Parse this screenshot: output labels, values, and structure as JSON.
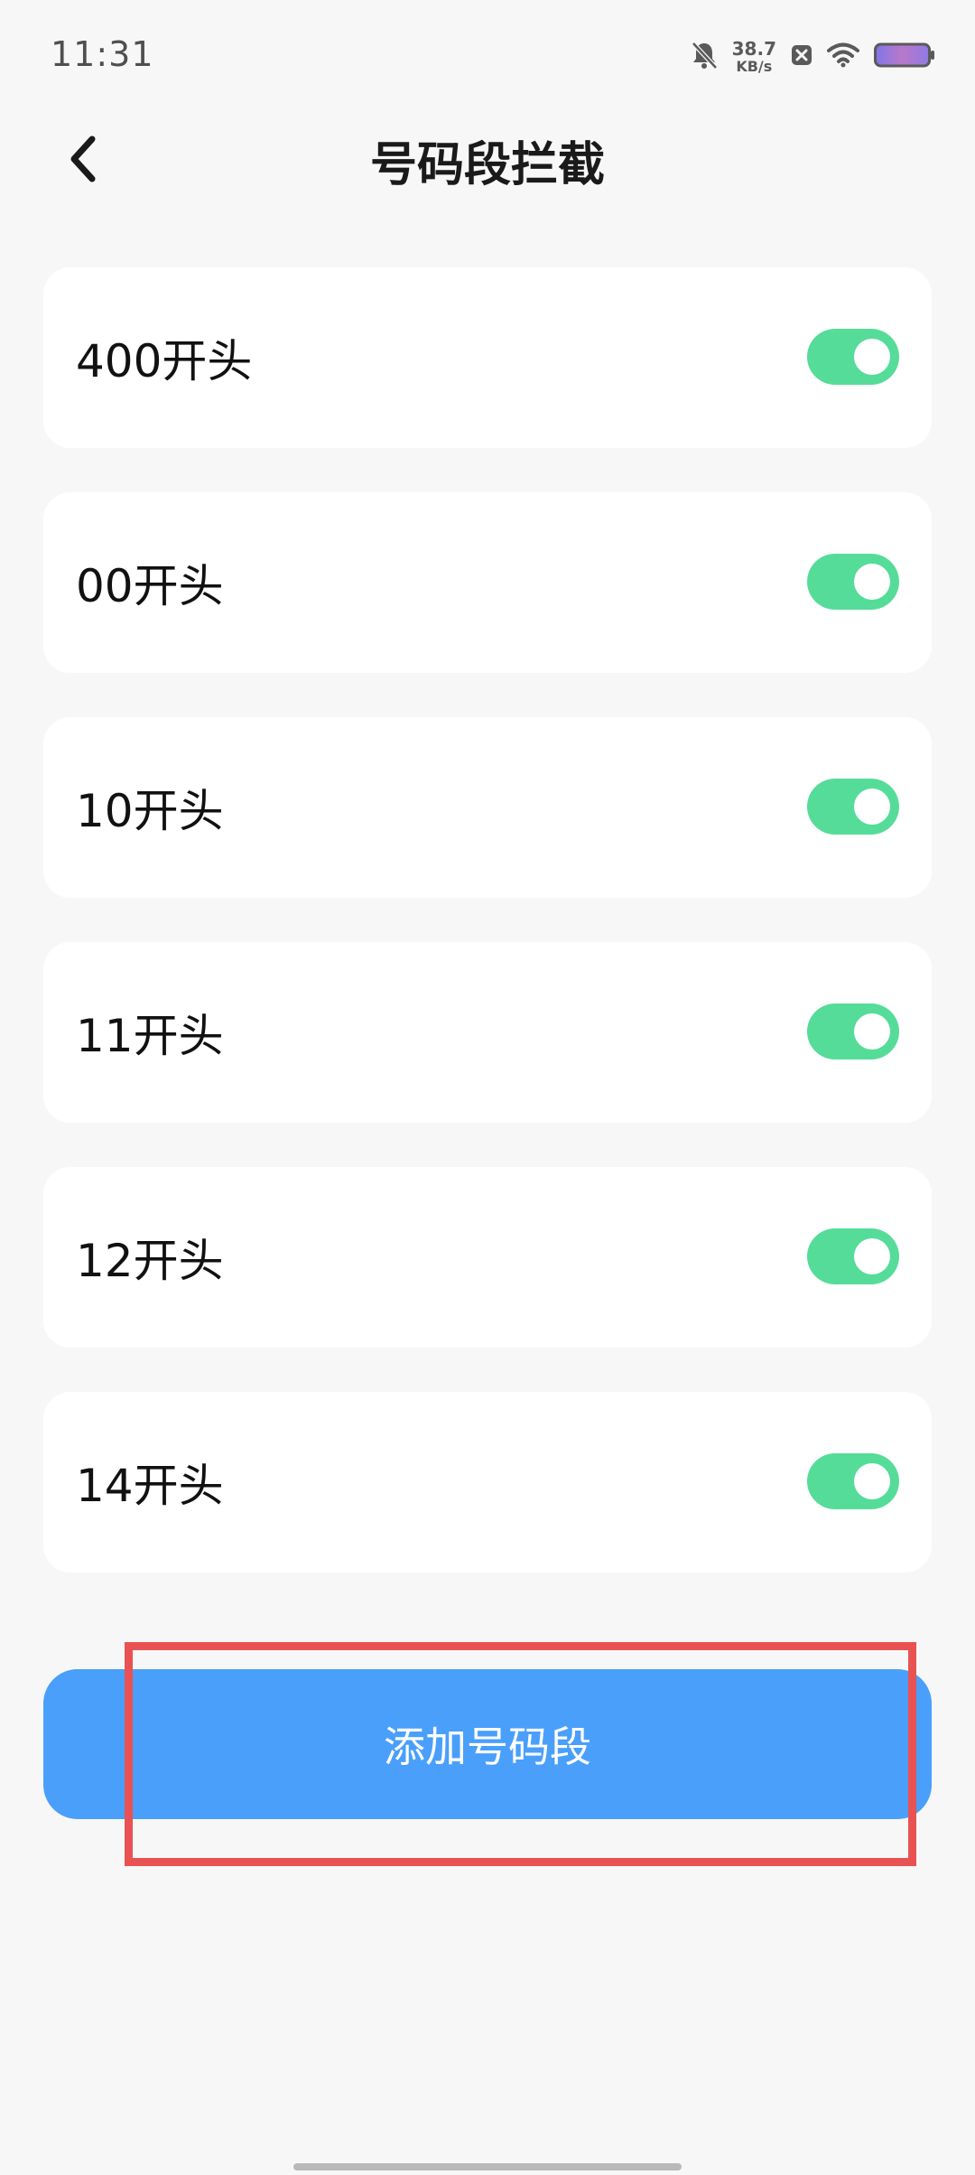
{
  "status_bar": {
    "time": "11:31",
    "net_speed_value": "38.7",
    "net_speed_unit": "KB/s",
    "icons": [
      "bell-muted-icon",
      "close-box-icon",
      "wifi-icon",
      "battery-icon"
    ]
  },
  "header": {
    "back_icon": "chevron-left-icon",
    "title": "号码段拦截"
  },
  "rules": [
    {
      "label": "400开头",
      "enabled": true
    },
    {
      "label": "00开头",
      "enabled": true
    },
    {
      "label": "10开头",
      "enabled": true
    },
    {
      "label": "11开头",
      "enabled": true
    },
    {
      "label": "12开头",
      "enabled": true
    },
    {
      "label": "14开头",
      "enabled": true
    }
  ],
  "add_button": {
    "label": "添加号码段"
  },
  "colors": {
    "toggle_on": "#55dc99",
    "primary_button": "#4a9ffb",
    "highlight": "#e95252"
  }
}
